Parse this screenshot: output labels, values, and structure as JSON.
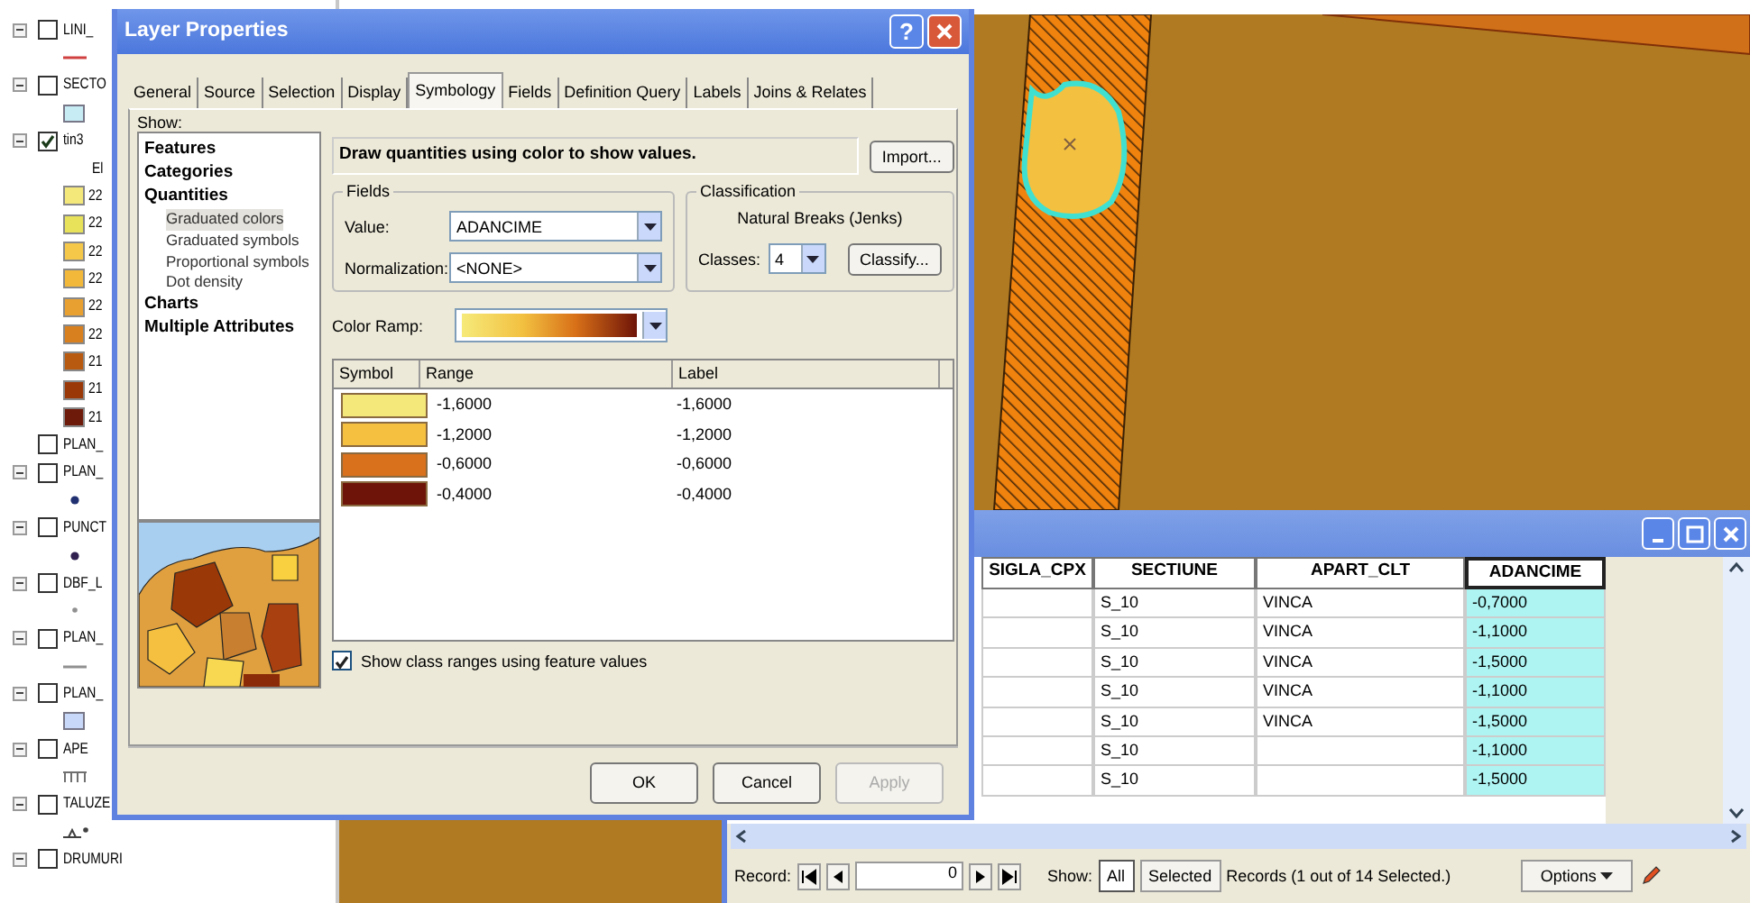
{
  "toc": [
    {
      "kind": "layer",
      "name": "LINI_",
      "checked": false,
      "expander": true
    },
    {
      "kind": "line-symbol",
      "color": "#d04040"
    },
    {
      "kind": "layer",
      "name": "SECTO",
      "checked": false,
      "expander": true
    },
    {
      "kind": "fill-symbol",
      "color": "#c8ecf4"
    },
    {
      "kind": "layer",
      "name": "tin3",
      "checked": true,
      "expander": true
    },
    {
      "kind": "heading",
      "name": "El"
    },
    {
      "kind": "class",
      "label": "22",
      "color": "#f5e87a"
    },
    {
      "kind": "class",
      "label": "22",
      "color": "#e8e25a"
    },
    {
      "kind": "class",
      "label": "22",
      "color": "#f5c84a"
    },
    {
      "kind": "class",
      "label": "22",
      "color": "#f2b83a"
    },
    {
      "kind": "class",
      "label": "22",
      "color": "#e8a030"
    },
    {
      "kind": "class",
      "label": "22",
      "color": "#d88020"
    },
    {
      "kind": "class",
      "label": "21",
      "color": "#b85a10"
    },
    {
      "kind": "class",
      "label": "21",
      "color": "#9a3808"
    },
    {
      "kind": "class",
      "label": "21",
      "color": "#6e1a0a"
    },
    {
      "kind": "layer",
      "name": "PLAN_",
      "checked": false,
      "expander": false
    },
    {
      "kind": "layer",
      "name": "PLAN_",
      "checked": false,
      "expander": true
    },
    {
      "kind": "point-symbol",
      "color": "#203070"
    },
    {
      "kind": "layer",
      "name": "PUNCT",
      "checked": false,
      "expander": true
    },
    {
      "kind": "point-symbol",
      "color": "#302050"
    },
    {
      "kind": "layer",
      "name": "DBF_L",
      "checked": false,
      "expander": true
    },
    {
      "kind": "dot-symbol",
      "color": "#909090"
    },
    {
      "kind": "layer",
      "name": "PLAN_",
      "checked": false,
      "expander": true
    },
    {
      "kind": "line-symbol",
      "color": "#909090"
    },
    {
      "kind": "layer",
      "name": "PLAN_",
      "checked": false,
      "expander": true
    },
    {
      "kind": "fill-symbol",
      "color": "#c8d8f8"
    },
    {
      "kind": "layer",
      "name": "APE",
      "checked": false,
      "expander": true
    },
    {
      "kind": "comb-symbol",
      "color": "#707070"
    },
    {
      "kind": "layer",
      "name": "TALUZE",
      "checked": false,
      "expander": true
    },
    {
      "kind": "slope-symbol",
      "color": "#404040"
    },
    {
      "kind": "layer",
      "name": "DRUMURI",
      "checked": false,
      "expander": true
    }
  ],
  "dialog": {
    "title": "Layer Properties",
    "help": "?",
    "tabs": [
      {
        "label": "General",
        "selected": false
      },
      {
        "label": "Source",
        "selected": false
      },
      {
        "label": "Selection",
        "selected": false
      },
      {
        "label": "Display",
        "selected": false
      },
      {
        "label": "Symbology",
        "selected": true
      },
      {
        "label": "Fields",
        "selected": false
      },
      {
        "label": "Definition Query",
        "selected": false
      },
      {
        "label": "Labels",
        "selected": false
      },
      {
        "label": "Joins & Relates",
        "selected": false
      }
    ],
    "show_label": "Show:",
    "show_tree": [
      {
        "label": "Features",
        "selected": false
      },
      {
        "label": "Categories",
        "selected": false
      },
      {
        "label": "Quantities",
        "selected": false,
        "children": [
          {
            "label": "Graduated colors",
            "selected": true
          },
          {
            "label": "Graduated symbols",
            "selected": false
          },
          {
            "label": "Proportional symbols",
            "selected": false
          },
          {
            "label": "Dot density",
            "selected": false
          }
        ]
      },
      {
        "label": "Charts",
        "selected": false
      },
      {
        "label": "Multiple Attributes",
        "selected": false
      }
    ],
    "description": "Draw quantities using color to show values.",
    "import_button": "Import...",
    "fields": {
      "title": "Fields",
      "value_label": "Value:",
      "value": "ADANCIME",
      "normalization_label": "Normalization:",
      "normalization": "<NONE>"
    },
    "classification": {
      "title": "Classification",
      "method": "Natural Breaks (Jenks)",
      "classes_label": "Classes:",
      "classes": "4",
      "classify_button": "Classify..."
    },
    "color_ramp_label": "Color Ramp:",
    "class_columns": [
      "Symbol",
      "Range",
      "Label"
    ],
    "classes": [
      {
        "color": "#f5e87a",
        "range": "-1,6000",
        "label": "-1,6000"
      },
      {
        "color": "#f5c040",
        "range": "-1,2000",
        "label": "-1,2000"
      },
      {
        "color": "#d8701c",
        "range": "-0,6000",
        "label": "-0,6000"
      },
      {
        "color": "#6e1408",
        "range": "-0,4000",
        "label": "-0,4000"
      }
    ],
    "show_ranges": {
      "label": "Show class ranges using feature values",
      "checked": true
    },
    "buttons": [
      {
        "label": "OK",
        "disabled": false
      },
      {
        "label": "Cancel",
        "disabled": false
      },
      {
        "label": "Apply",
        "disabled": true
      }
    ]
  },
  "table": {
    "columns": [
      {
        "label": "SIGLA_CPX",
        "selected": false
      },
      {
        "label": "SECTIUNE",
        "selected": false
      },
      {
        "label": "APART_CLT",
        "selected": false
      },
      {
        "label": "ADANCIME",
        "selected": true
      }
    ],
    "rows": [
      [
        "",
        "S_10",
        "VINCA",
        "-0,7000"
      ],
      [
        "",
        "S_10",
        "VINCA",
        "-1,1000"
      ],
      [
        "",
        "S_10",
        "VINCA",
        "-1,5000"
      ],
      [
        "",
        "S_10",
        "VINCA",
        "-1,1000"
      ],
      [
        "",
        "S_10",
        "VINCA",
        "-1,5000"
      ],
      [
        "",
        "S_10",
        "",
        "-1,1000"
      ],
      [
        "",
        "S_10",
        "",
        "-1,5000"
      ]
    ],
    "record_label": "Record:",
    "record": "0",
    "show_label": "Show:",
    "show_buttons": [
      {
        "label": "All",
        "selected": true
      },
      {
        "label": "Selected",
        "selected": false
      }
    ],
    "records_status": "Records (1 out of 14 Selected.)",
    "options_button": "Options"
  }
}
